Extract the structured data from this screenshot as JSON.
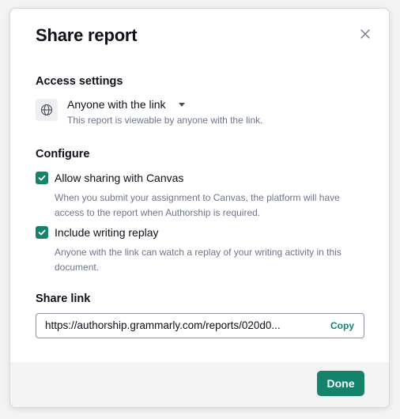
{
  "dialog": {
    "title": "Share report",
    "close_icon": "close-icon"
  },
  "access": {
    "heading": "Access settings",
    "icon": "globe-icon",
    "selected_option": "Anyone with the link",
    "description": "This report is viewable by anyone with the link."
  },
  "configure": {
    "heading": "Configure",
    "options": [
      {
        "label": "Allow sharing with Canvas",
        "checked": true,
        "description": "When you submit your assignment to Canvas, the platform will have access to the report when Authorship is required."
      },
      {
        "label": "Include writing replay",
        "checked": true,
        "description": "Anyone with the link can watch a replay of your writing activity in this document."
      }
    ]
  },
  "share_link": {
    "heading": "Share link",
    "value": "https://authorship.grammarly.com/reports/020d0...",
    "copy_label": "Copy"
  },
  "footer": {
    "done_label": "Done"
  },
  "colors": {
    "accent": "#15826b",
    "text_primary": "#0e101a",
    "text_secondary": "#6d758d",
    "footer_bg": "#f3f3f4"
  }
}
